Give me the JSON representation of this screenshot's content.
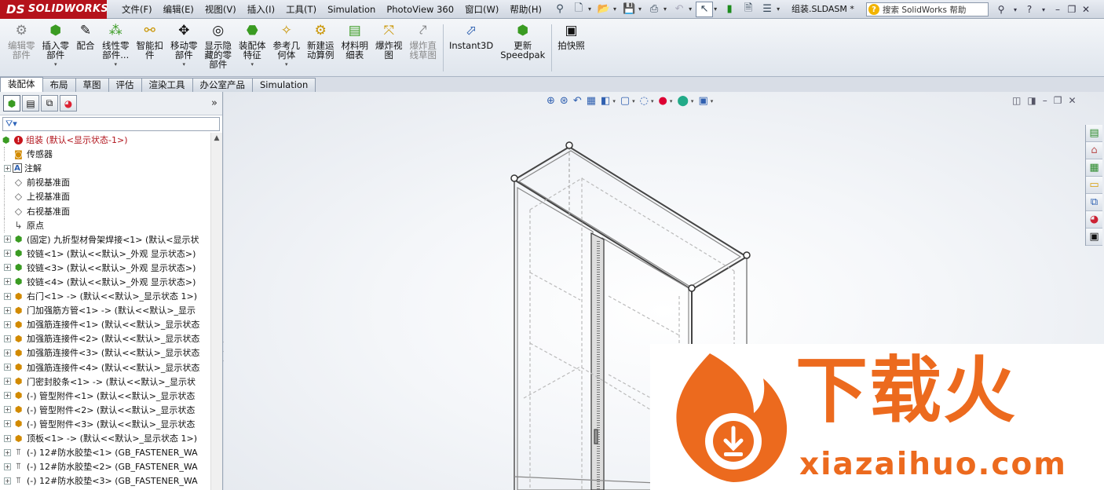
{
  "menubar": {
    "logo": "SOLIDWORKS",
    "logo_mark": "DS",
    "menus": [
      "文件(F)",
      "编辑(E)",
      "视图(V)",
      "插入(I)",
      "工具(T)",
      "Simulation",
      "PhotoView 360",
      "窗口(W)",
      "帮助(H)"
    ],
    "doc_title": "组装.SLDASM *",
    "search_placeholder": "搜索 SolidWorks 帮助"
  },
  "ribbon": {
    "buttons": [
      {
        "label": "编辑零\n部件",
        "icon": "edit-component-icon",
        "dim": true,
        "drop": false
      },
      {
        "label": "插入零\n部件",
        "icon": "insert-component-icon",
        "dim": false,
        "drop": true
      },
      {
        "label": "配合",
        "icon": "mate-icon",
        "dim": false,
        "drop": false
      },
      {
        "label": "线性零\n部件...",
        "icon": "linear-pattern-icon",
        "dim": false,
        "drop": true
      },
      {
        "label": "智能扣\n件",
        "icon": "smart-fastener-icon",
        "dim": false,
        "drop": false
      },
      {
        "label": "移动零\n部件",
        "icon": "move-component-icon",
        "dim": false,
        "drop": true
      },
      {
        "label": "显示隐\n藏的零\n部件",
        "icon": "show-hidden-icon",
        "dim": false,
        "drop": false
      },
      {
        "label": "装配体\n特征",
        "icon": "assembly-feature-icon",
        "dim": false,
        "drop": true
      },
      {
        "label": "参考几\n何体",
        "icon": "reference-geometry-icon",
        "dim": false,
        "drop": true
      },
      {
        "label": "新建运\n动算例",
        "icon": "motion-study-icon",
        "dim": false,
        "drop": false
      },
      {
        "label": "材料明\n细表",
        "icon": "bom-icon",
        "dim": false,
        "drop": false
      },
      {
        "label": "爆炸视\n图",
        "icon": "exploded-view-icon",
        "dim": false,
        "drop": false
      },
      {
        "label": "爆炸直\n线草图",
        "icon": "explode-line-icon",
        "dim": true,
        "drop": false
      },
      {
        "label": "Instant3D",
        "icon": "instant3d-icon",
        "dim": false,
        "drop": false
      },
      {
        "label": "更新\nSpeedpak",
        "icon": "speedpak-icon",
        "dim": false,
        "drop": false
      },
      {
        "label": "拍快照",
        "icon": "snapshot-icon",
        "dim": false,
        "drop": false
      }
    ]
  },
  "tabs": [
    "装配体",
    "布局",
    "草图",
    "评估",
    "渲染工具",
    "办公室产品",
    "Simulation"
  ],
  "tree": {
    "items": [
      {
        "label": "组装  (默认<显示状态-1>)",
        "type": "root",
        "expander": "none"
      },
      {
        "label": "传感器",
        "type": "sensor",
        "expander": "none"
      },
      {
        "label": "注解",
        "type": "annotation",
        "expander": "plus"
      },
      {
        "label": "前视基准面",
        "type": "plane",
        "expander": "none"
      },
      {
        "label": "上视基准面",
        "type": "plane",
        "expander": "none"
      },
      {
        "label": "右视基准面",
        "type": "plane",
        "expander": "none"
      },
      {
        "label": "原点",
        "type": "origin",
        "expander": "none"
      },
      {
        "label": "(固定) 九折型材骨架焊接<1> (默认<显示状",
        "type": "part",
        "expander": "plus"
      },
      {
        "label": "铰链<1> (默认<<默认>_外观 显示状态>)",
        "type": "part",
        "expander": "plus"
      },
      {
        "label": "铰链<3> (默认<<默认>_外观 显示状态>)",
        "type": "part",
        "expander": "plus"
      },
      {
        "label": "铰链<4> (默认<<默认>_外观 显示状态>)",
        "type": "part",
        "expander": "plus"
      },
      {
        "label": "右门<1> -> (默认<<默认>_显示状态 1>)",
        "type": "partw",
        "expander": "plus"
      },
      {
        "label": "门加强筋方管<1> -> (默认<<默认>_显示",
        "type": "partw",
        "expander": "plus"
      },
      {
        "label": "加强筋连接件<1> (默认<<默认>_显示状态",
        "type": "partw",
        "expander": "plus"
      },
      {
        "label": "加强筋连接件<2> (默认<<默认>_显示状态",
        "type": "partw",
        "expander": "plus"
      },
      {
        "label": "加强筋连接件<3> (默认<<默认>_显示状态",
        "type": "partw",
        "expander": "plus"
      },
      {
        "label": "加强筋连接件<4> (默认<<默认>_显示状态",
        "type": "partw",
        "expander": "plus"
      },
      {
        "label": "门密封胶条<1> -> (默认<<默认>_显示状",
        "type": "partw",
        "expander": "plus"
      },
      {
        "label": "(-) 管型附件<1> (默认<<默认>_显示状态",
        "type": "partw",
        "expander": "plus"
      },
      {
        "label": "(-) 管型附件<2> (默认<<默认>_显示状态",
        "type": "partw",
        "expander": "plus"
      },
      {
        "label": "(-) 管型附件<3> (默认<<默认>_显示状态",
        "type": "partw",
        "expander": "plus"
      },
      {
        "label": "顶板<1> -> (默认<<默认>_显示状态 1>)",
        "type": "partw",
        "expander": "plus"
      },
      {
        "label": "(-) 12#防水胶垫<1> (GB_FASTENER_WA",
        "type": "bolt",
        "expander": "plus"
      },
      {
        "label": "(-) 12#防水胶垫<2> (GB_FASTENER_WA",
        "type": "bolt",
        "expander": "plus"
      },
      {
        "label": "(-) 12#防水胶垫<3> (GB_FASTENER_WA",
        "type": "bolt",
        "expander": "plus"
      },
      {
        "label": "(-) 12#防水胶垫<4> (GB_FASTENER_WA",
        "type": "bolt",
        "expander": "plus"
      }
    ]
  },
  "watermark": {
    "text": "下载火",
    "url": "xiazaihuo.com",
    "color": "#ec6a1e"
  },
  "colors": {
    "brand": "#b5121b",
    "root_label": "#b1131b"
  }
}
